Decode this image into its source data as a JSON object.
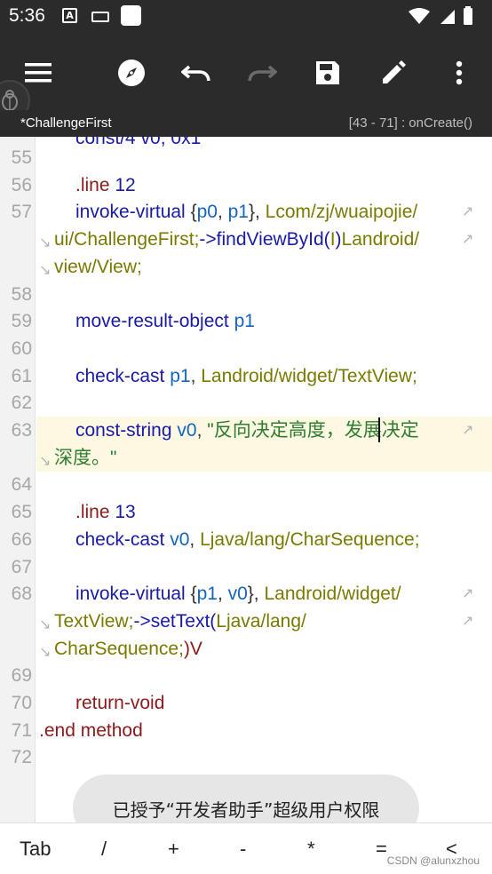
{
  "status_bar": {
    "time": "5:36",
    "a_icon": "A"
  },
  "toolbar": {
    "icons": [
      "menu-icon",
      "compass-icon",
      "undo-icon",
      "redo-icon",
      "save-icon",
      "edit-icon",
      "more-icon"
    ]
  },
  "tab": {
    "file_name": "*ChallengeFirst",
    "position": "[43 - 71] : onCreate()"
  },
  "editor": {
    "lines": [
      {
        "n": "55",
        "parts": []
      },
      {
        "n": "56",
        "parts": [
          [
            ".line ",
            "dir"
          ],
          [
            "12",
            "num"
          ]
        ]
      },
      {
        "n": "57",
        "parts": [
          [
            "invoke-virtual ",
            "kw"
          ],
          [
            "{",
            "punc"
          ],
          [
            "p0",
            "reg"
          ],
          [
            ", ",
            "punc"
          ],
          [
            "p1",
            "reg"
          ],
          [
            "}, ",
            "punc"
          ],
          [
            "Lcom/zj/wuaipojie/",
            "type"
          ]
        ]
      },
      {
        "n": "",
        "parts": [
          [
            "ui/ChallengeFirst;",
            "type"
          ],
          [
            "->findViewById(",
            "kw"
          ],
          [
            "I",
            "type"
          ],
          [
            ")",
            "kw"
          ],
          [
            "Landroid/",
            "type"
          ]
        ],
        "cont": true
      },
      {
        "n": "",
        "parts": [
          [
            "view/View;",
            "type"
          ]
        ],
        "cont": true
      },
      {
        "n": "58",
        "parts": []
      },
      {
        "n": "59",
        "parts": [
          [
            "move-result-object ",
            "kw"
          ],
          [
            "p1",
            "reg"
          ]
        ]
      },
      {
        "n": "60",
        "parts": []
      },
      {
        "n": "61",
        "parts": [
          [
            "check-cast ",
            "kw"
          ],
          [
            "p1",
            "reg"
          ],
          [
            ", ",
            "punc"
          ],
          [
            "Landroid/widget/TextView;",
            "type"
          ]
        ]
      },
      {
        "n": "62",
        "parts": []
      },
      {
        "n": "63",
        "parts": [
          [
            "const-string ",
            "kw"
          ],
          [
            "v0",
            "reg"
          ],
          [
            ", ",
            "punc"
          ],
          [
            "\"反向决定高度，发展决定",
            "str"
          ]
        ],
        "hl": true
      },
      {
        "n": "",
        "parts": [
          [
            "深度。\"",
            "str"
          ]
        ],
        "cont": true,
        "hl": true
      },
      {
        "n": "64",
        "parts": []
      },
      {
        "n": "65",
        "parts": [
          [
            ".line ",
            "dir"
          ],
          [
            "13",
            "num"
          ]
        ]
      },
      {
        "n": "66",
        "parts": [
          [
            "check-cast ",
            "kw"
          ],
          [
            "v0",
            "reg"
          ],
          [
            ", ",
            "punc"
          ],
          [
            "Ljava/lang/CharSequence;",
            "type"
          ]
        ]
      },
      {
        "n": "67",
        "parts": []
      },
      {
        "n": "68",
        "parts": [
          [
            "invoke-virtual ",
            "kw"
          ],
          [
            "{",
            "punc"
          ],
          [
            "p1",
            "reg"
          ],
          [
            ", ",
            "punc"
          ],
          [
            "v0",
            "reg"
          ],
          [
            "}, ",
            "punc"
          ],
          [
            "Landroid/widget/",
            "type"
          ]
        ]
      },
      {
        "n": "",
        "parts": [
          [
            "TextView;",
            "type"
          ],
          [
            "->setText(",
            "kw"
          ],
          [
            "Ljava/lang/",
            "type"
          ]
        ],
        "cont": true
      },
      {
        "n": "",
        "parts": [
          [
            "CharSequence;",
            "type"
          ],
          [
            ")V",
            "dir"
          ]
        ],
        "cont": true
      },
      {
        "n": "69",
        "parts": []
      },
      {
        "n": "70",
        "parts": [
          [
            "return-void",
            "dir"
          ]
        ]
      },
      {
        "n": "71",
        "parts": [
          [
            ".end method",
            "dir"
          ]
        ],
        "outdent": true
      },
      {
        "n": "72",
        "parts": []
      }
    ]
  },
  "bottom_keys": [
    "Tab",
    "/",
    "+",
    "-",
    "*",
    "=",
    "<"
  ],
  "toast": "已授予“开发者助手”超级用户权限",
  "watermark": "CSDN @alunxzhou"
}
